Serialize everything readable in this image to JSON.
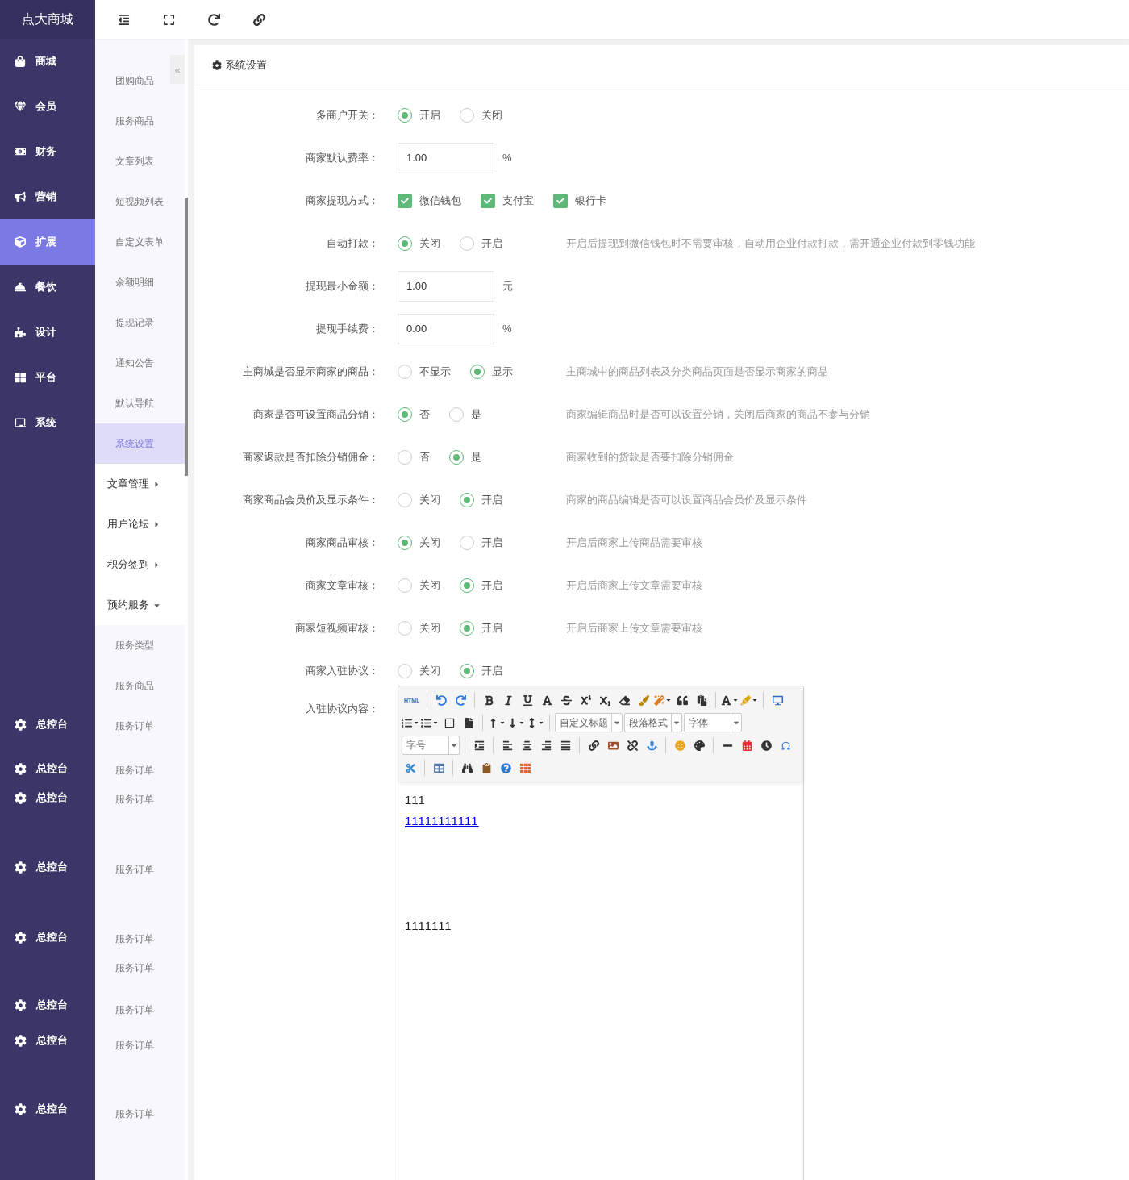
{
  "brand": "点大商城",
  "nav": [
    {
      "label": "商城",
      "selected": false
    },
    {
      "label": "会员",
      "selected": false
    },
    {
      "label": "财务",
      "selected": false
    },
    {
      "label": "营销",
      "selected": false
    },
    {
      "label": "扩展",
      "selected": true
    },
    {
      "label": "餐饮",
      "selected": false
    },
    {
      "label": "设计",
      "selected": false
    },
    {
      "label": "平台",
      "selected": false
    },
    {
      "label": "系统",
      "selected": false
    }
  ],
  "nav_extra": [
    {
      "label": "总控台"
    },
    {
      "label": "总控台"
    },
    {
      "label": "总控台"
    },
    {
      "label": "总控台"
    },
    {
      "label": "总控台"
    },
    {
      "label": "总控台"
    },
    {
      "label": "总控台"
    },
    {
      "label": "总控台"
    }
  ],
  "sub_sidebar": {
    "items": [
      {
        "kind": "link",
        "label": "团购商品",
        "selected": false
      },
      {
        "kind": "link",
        "label": "服务商品",
        "selected": false
      },
      {
        "kind": "link",
        "label": "文章列表",
        "selected": false
      },
      {
        "kind": "link",
        "label": "短视频列表",
        "selected": false
      },
      {
        "kind": "link",
        "label": "自定义表单",
        "selected": false
      },
      {
        "kind": "link",
        "label": "余额明细",
        "selected": false
      },
      {
        "kind": "link",
        "label": "提现记录",
        "selected": false
      },
      {
        "kind": "link",
        "label": "通知公告",
        "selected": false
      },
      {
        "kind": "link",
        "label": "默认导航",
        "selected": false
      },
      {
        "kind": "link",
        "label": "系统设置",
        "selected": true
      },
      {
        "kind": "group",
        "label": "文章管理",
        "expanded": false
      },
      {
        "kind": "group",
        "label": "用户论坛",
        "expanded": false
      },
      {
        "kind": "group",
        "label": "积分签到",
        "expanded": false
      },
      {
        "kind": "group",
        "label": "预约服务",
        "expanded": true,
        "children": [
          {
            "label": "服务类型",
            "selected": false
          },
          {
            "label": "服务商品",
            "selected": false
          },
          {
            "label": "服务订单",
            "selected": false
          },
          {
            "label": "服务订单",
            "selected": false
          },
          {
            "label": "服务订单",
            "selected": false
          },
          {
            "label": "服务订单",
            "selected": false
          },
          {
            "label": "服务订单",
            "selected": false
          },
          {
            "label": "服务订单",
            "selected": false
          },
          {
            "label": "服务订单",
            "selected": false
          },
          {
            "label": "服务订单",
            "selected": false
          },
          {
            "label": "服务订单",
            "selected": false
          }
        ]
      }
    ]
  },
  "collapse_button": "«",
  "panel_title": "系统设置",
  "form": [
    {
      "label": "多商户开关：",
      "kind": "radio",
      "options": [
        {
          "label": "开启",
          "selected": true
        },
        {
          "label": "关闭",
          "selected": false
        }
      ]
    },
    {
      "label": "商家默认费率：",
      "kind": "input",
      "value": "1.00",
      "unit": "%"
    },
    {
      "label": "商家提现方式：",
      "kind": "checkbox",
      "options": [
        {
          "label": "微信钱包",
          "checked": true
        },
        {
          "label": "支付宝",
          "checked": true
        },
        {
          "label": "银行卡",
          "checked": true
        }
      ]
    },
    {
      "label": "自动打款：",
      "kind": "radio",
      "options": [
        {
          "label": "关闭",
          "selected": true
        },
        {
          "label": "开启",
          "selected": false
        }
      ],
      "help": "开启后提现到微信钱包时不需要审核，自动用企业付款打款，需开通企业付款到零钱功能"
    },
    {
      "label": "提现最小金额：",
      "kind": "input",
      "value": "1.00",
      "unit": "元"
    },
    {
      "label": "提现手续费：",
      "kind": "input",
      "value": "0.00",
      "unit": "%"
    },
    {
      "label": "主商城是否显示商家的商品：",
      "kind": "radio",
      "options": [
        {
          "label": "不显示",
          "selected": false
        },
        {
          "label": "显示",
          "selected": true
        }
      ],
      "help": "主商城中的商品列表及分类商品页面是否显示商家的商品"
    },
    {
      "label": "商家是否可设置商品分销：",
      "kind": "radio",
      "options": [
        {
          "label": "否",
          "selected": true
        },
        {
          "label": "是",
          "selected": false
        }
      ],
      "help": "商家编辑商品时是否可以设置分销，关闭后商家的商品不参与分销"
    },
    {
      "label": "商家返款是否扣除分销佣金：",
      "kind": "radio",
      "options": [
        {
          "label": "否",
          "selected": false
        },
        {
          "label": "是",
          "selected": true
        }
      ],
      "help": "商家收到的货款是否要扣除分销佣金"
    },
    {
      "label": "商家商品会员价及显示条件：",
      "kind": "radio",
      "options": [
        {
          "label": "关闭",
          "selected": false
        },
        {
          "label": "开启",
          "selected": true
        }
      ],
      "help": "商家的商品编辑是否可以设置商品会员价及显示条件"
    },
    {
      "label": "商家商品审核：",
      "kind": "radio",
      "options": [
        {
          "label": "关闭",
          "selected": true
        },
        {
          "label": "开启",
          "selected": false
        }
      ],
      "help": "开启后商家上传商品需要审核"
    },
    {
      "label": "商家文章审核：",
      "kind": "radio",
      "options": [
        {
          "label": "关闭",
          "selected": false
        },
        {
          "label": "开启",
          "selected": true
        }
      ],
      "help": "开启后商家上传文章需要审核"
    },
    {
      "label": "商家短视频审核：",
      "kind": "radio",
      "options": [
        {
          "label": "关闭",
          "selected": false
        },
        {
          "label": "开启",
          "selected": true
        }
      ],
      "help": "开启后商家上传文章需要审核"
    },
    {
      "label": "商家入驻协议：",
      "kind": "radio",
      "options": [
        {
          "label": "关闭",
          "selected": false
        },
        {
          "label": "开启",
          "selected": true
        }
      ]
    },
    {
      "label": "入驻协议内容：",
      "kind": "editor"
    }
  ],
  "editor": {
    "toolbar": [
      [
        {
          "kind": "html",
          "label": "HTML"
        },
        {
          "kind": "sep"
        },
        {
          "kind": "icon"
        },
        {
          "kind": "icon"
        },
        {
          "kind": "sep"
        },
        {
          "kind": "icon"
        },
        {
          "kind": "icon"
        },
        {
          "kind": "icon"
        },
        {
          "kind": "icon"
        },
        {
          "kind": "icon"
        },
        {
          "kind": "icon"
        },
        {
          "kind": "icon"
        },
        {
          "kind": "icon"
        },
        {
          "kind": "icon"
        },
        {
          "kind": "icon",
          "dropdown": true
        },
        {
          "kind": "icon"
        },
        {
          "kind": "icon"
        },
        {
          "kind": "sep"
        },
        {
          "kind": "icon",
          "dropdown": true
        },
        {
          "kind": "icon",
          "dropdown": true
        },
        {
          "kind": "sep"
        },
        {
          "kind": "icon"
        }
      ],
      [
        {
          "kind": "icon",
          "dropdown": true
        },
        {
          "kind": "icon",
          "dropdown": true
        },
        {
          "kind": "icon"
        },
        {
          "kind": "icon"
        },
        {
          "kind": "sep"
        },
        {
          "kind": "icon",
          "dropdown": true
        },
        {
          "kind": "icon",
          "dropdown": true
        },
        {
          "kind": "icon",
          "dropdown": true
        },
        {
          "kind": "sep"
        },
        {
          "kind": "select",
          "value": "自定义标题"
        },
        {
          "kind": "select",
          "value": "段落格式"
        },
        {
          "kind": "select",
          "value": "字体"
        }
      ],
      [
        {
          "kind": "select",
          "value": "字号"
        },
        {
          "kind": "sep"
        },
        {
          "kind": "icon"
        },
        {
          "kind": "sep"
        },
        {
          "kind": "icon"
        },
        {
          "kind": "icon"
        },
        {
          "kind": "icon"
        },
        {
          "kind": "icon"
        },
        {
          "kind": "sep"
        },
        {
          "kind": "icon"
        },
        {
          "kind": "icon"
        },
        {
          "kind": "icon"
        },
        {
          "kind": "icon"
        },
        {
          "kind": "sep"
        },
        {
          "kind": "icon"
        },
        {
          "kind": "icon"
        },
        {
          "kind": "sep"
        },
        {
          "kind": "icon"
        },
        {
          "kind": "icon"
        },
        {
          "kind": "icon"
        },
        {
          "kind": "icon"
        }
      ],
      [
        {
          "kind": "icon"
        },
        {
          "kind": "sep"
        },
        {
          "kind": "icon"
        },
        {
          "kind": "sep"
        },
        {
          "kind": "icon"
        },
        {
          "kind": "icon"
        },
        {
          "kind": "icon"
        },
        {
          "kind": "icon"
        }
      ]
    ],
    "content": [
      {
        "kind": "text",
        "text": "111"
      },
      {
        "kind": "link",
        "text": "11111111111"
      },
      {
        "kind": "text",
        "text": "1111111"
      }
    ]
  }
}
